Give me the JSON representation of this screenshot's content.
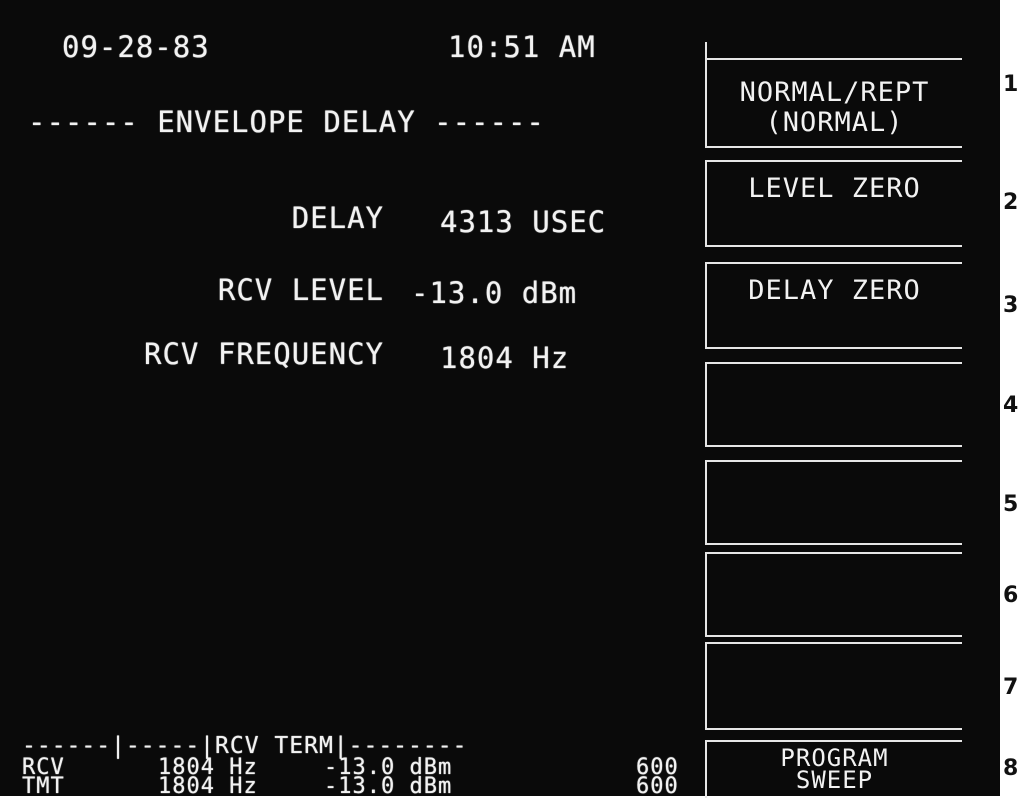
{
  "header": {
    "date": "09-28-83",
    "time": "10:51 AM",
    "title": "------ ENVELOPE DELAY ------"
  },
  "readings": [
    {
      "label": "DELAY",
      "value": "4313 USEC"
    },
    {
      "label": "RCV LEVEL",
      "value": "-13.0 dBm"
    },
    {
      "label": "RCV FREQUENCY",
      "value": "1804 Hz"
    }
  ],
  "status": {
    "divider": "------|-----|RCV TERM|--------",
    "rows": [
      {
        "name": "RCV",
        "frequency": "1804 Hz",
        "level": "-13.0 dBm",
        "impedance": "600"
      },
      {
        "name": "TMT",
        "frequency": "1804 Hz",
        "level": "-13.0 dBm",
        "impedance": "600"
      }
    ]
  },
  "softkeys": [
    {
      "line1": "NORMAL/REPT",
      "line2": "(NORMAL)"
    },
    {
      "line1": "LEVEL ZERO",
      "line2": ""
    },
    {
      "line1": "DELAY ZERO",
      "line2": ""
    },
    {
      "line1": "",
      "line2": ""
    },
    {
      "line1": "",
      "line2": ""
    },
    {
      "line1": "",
      "line2": ""
    },
    {
      "line1": "",
      "line2": ""
    },
    {
      "line1": "PROGRAM",
      "line2": "SWEEP"
    }
  ],
  "key_numbers": [
    "1",
    "2",
    "3",
    "4",
    "5",
    "6",
    "7",
    "8"
  ]
}
